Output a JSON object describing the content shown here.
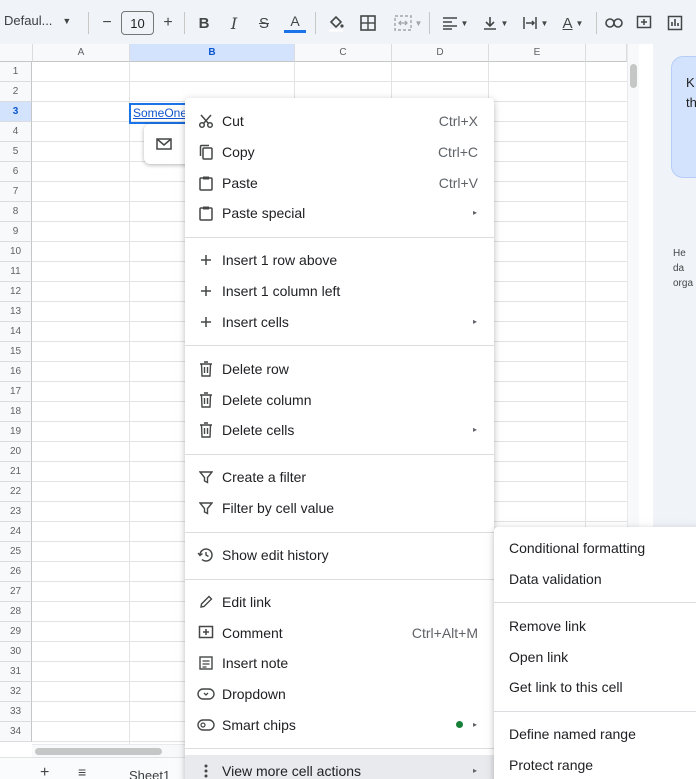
{
  "toolbar": {
    "font_name": "Defaul...",
    "font_size": "10",
    "decrease_size": "−",
    "increase_size": "+",
    "bold": "B",
    "italic": "I",
    "strikethrough": "S",
    "text_color": "A"
  },
  "grid": {
    "columns": [
      "A",
      "B",
      "C",
      "D",
      "E"
    ],
    "rows": [
      "1",
      "2",
      "3",
      "4",
      "5",
      "6",
      "7",
      "8",
      "9",
      "10",
      "11",
      "12",
      "13",
      "14",
      "15",
      "16",
      "17",
      "18",
      "19",
      "20",
      "21",
      "22",
      "23",
      "24",
      "25",
      "26",
      "27",
      "28",
      "29",
      "30",
      "31",
      "32",
      "33",
      "34"
    ],
    "selected_column": "B",
    "selected_row": "3",
    "cell_b3_text": "SomeOne"
  },
  "sheets_bar": {
    "add_label": "+",
    "menu_label": "≡",
    "active_sheet": "Sheet1"
  },
  "side_panel": {
    "card_text_1": "K",
    "card_text_2": "th",
    "body_text_1": "He",
    "body_text_2": "da",
    "body_text_3": "orga"
  },
  "context_menu": {
    "cut": {
      "label": "Cut",
      "shortcut": "Ctrl+X"
    },
    "copy": {
      "label": "Copy",
      "shortcut": "Ctrl+C"
    },
    "paste": {
      "label": "Paste",
      "shortcut": "Ctrl+V"
    },
    "paste_special": {
      "label": "Paste special"
    },
    "insert_row_above": {
      "label": "Insert 1 row above"
    },
    "insert_column_left": {
      "label": "Insert 1 column left"
    },
    "insert_cells": {
      "label": "Insert cells"
    },
    "delete_row": {
      "label": "Delete row"
    },
    "delete_column": {
      "label": "Delete column"
    },
    "delete_cells": {
      "label": "Delete cells"
    },
    "create_filter": {
      "label": "Create a filter"
    },
    "filter_by_value": {
      "label": "Filter by cell value"
    },
    "show_edit_history": {
      "label": "Show edit history"
    },
    "edit_link": {
      "label": "Edit link"
    },
    "comment": {
      "label": "Comment",
      "shortcut": "Ctrl+Alt+M"
    },
    "insert_note": {
      "label": "Insert note"
    },
    "dropdown": {
      "label": "Dropdown"
    },
    "smart_chips": {
      "label": "Smart chips"
    },
    "view_more": {
      "label": "View more cell actions"
    },
    "submenu_arrow": "▸"
  },
  "submenu": {
    "conditional_formatting": "Conditional formatting",
    "data_validation": "Data validation",
    "remove_link": "Remove link",
    "open_link": "Open link",
    "get_link": "Get link to this cell",
    "define_named_range": "Define named range",
    "protect_range": "Protect range"
  },
  "colors": {
    "accent": "#1a73e8",
    "link": "#1155cc",
    "selected_header": "#d3e3fd",
    "smart_chip_dot": "#188038"
  }
}
